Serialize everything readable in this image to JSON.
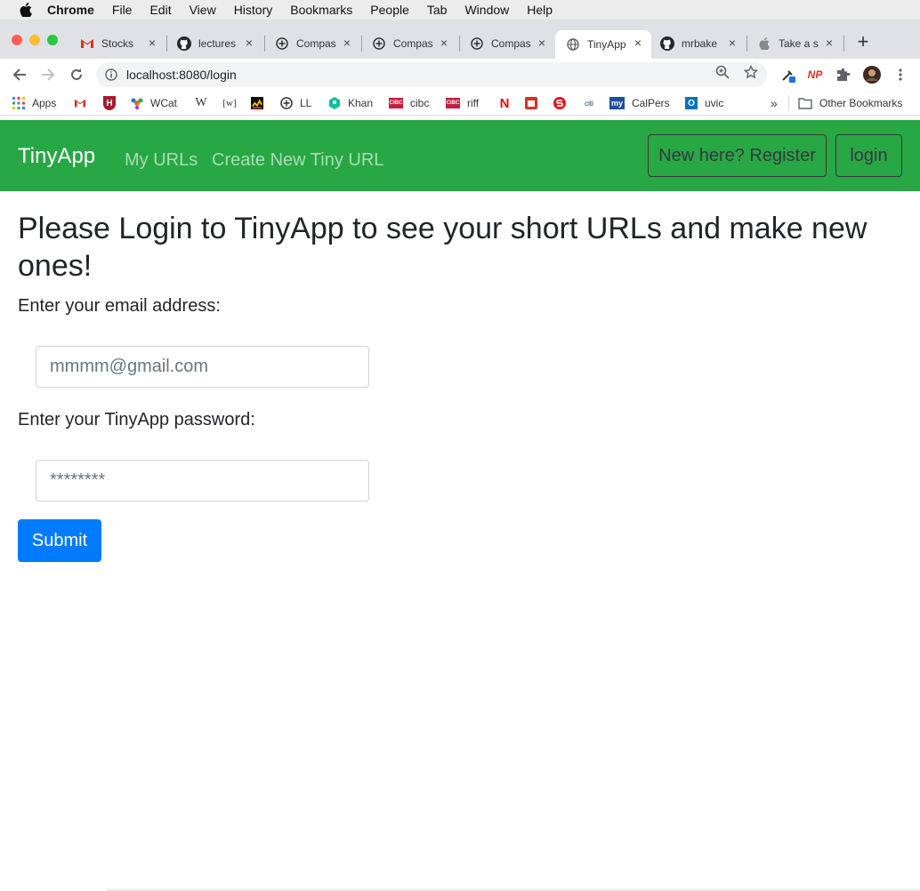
{
  "menubar": {
    "items": [
      "Chrome",
      "File",
      "Edit",
      "View",
      "History",
      "Bookmarks",
      "People",
      "Tab",
      "Window",
      "Help"
    ]
  },
  "tabs": [
    {
      "label": "Stocks ",
      "icon": "gmail-icon",
      "active": false
    },
    {
      "label": "lectures",
      "icon": "github-icon",
      "active": false
    },
    {
      "label": "Compas",
      "icon": "compass-icon",
      "active": false
    },
    {
      "label": "Compas",
      "icon": "compass-icon",
      "active": false
    },
    {
      "label": "Compas",
      "icon": "compass-icon",
      "active": false
    },
    {
      "label": "TinyApp",
      "icon": "globe-icon",
      "active": true
    },
    {
      "label": "mrbake",
      "icon": "github-icon",
      "active": false
    },
    {
      "label": "Take a s",
      "icon": "apple-icon",
      "active": false
    }
  ],
  "toolbar": {
    "url": "localhost:8080/login",
    "np_label": "NP"
  },
  "bookmarks": {
    "items": [
      {
        "label": "Apps",
        "icon": "apps-grid-icon"
      },
      {
        "label": "",
        "icon": "gmail-icon"
      },
      {
        "label": "",
        "icon": "harvard-icon"
      },
      {
        "label": "WCat",
        "icon": "worldcat-icon"
      },
      {
        "label": "",
        "icon": "wikipedia-icon",
        "glyph": "W"
      },
      {
        "label": "",
        "icon": "wiktionary-icon",
        "glyph": "[w]"
      },
      {
        "label": "",
        "icon": "chart-icon"
      },
      {
        "label": "LL",
        "icon": "compass-icon"
      },
      {
        "label": "Khan",
        "icon": "khan-icon"
      },
      {
        "label": "cibc",
        "icon": "cibc-icon"
      },
      {
        "label": "riff",
        "icon": "cibc-icon"
      },
      {
        "label": "",
        "icon": "netflix-icon",
        "glyph": "N"
      },
      {
        "label": "",
        "icon": "calendar-icon"
      },
      {
        "label": "",
        "icon": "scotiabank-icon"
      },
      {
        "label": "",
        "icon": "citi-icon",
        "glyph": "citi"
      },
      {
        "label": "CalPers",
        "icon": "my-icon",
        "glyph": "my"
      },
      {
        "label": "uvic",
        "icon": "outlook-icon",
        "glyph": "O"
      }
    ],
    "overflow": "»",
    "other": "Other Bookmarks"
  },
  "navbar": {
    "brand": "TinyApp",
    "links": [
      "My URLs",
      "Create New Tiny URL"
    ],
    "register": "New here? Register",
    "login": "login"
  },
  "colors": {
    "navbar": "#28a745",
    "submit": "#007bff"
  },
  "form": {
    "heading": "Please Login to TinyApp to see your short URLs and make new ones!",
    "email_label": "Enter your email address:",
    "email_placeholder": "mmmm@gmail.com",
    "password_label": "Enter your TinyApp password:",
    "password_placeholder": "********",
    "submit": "Submit"
  }
}
